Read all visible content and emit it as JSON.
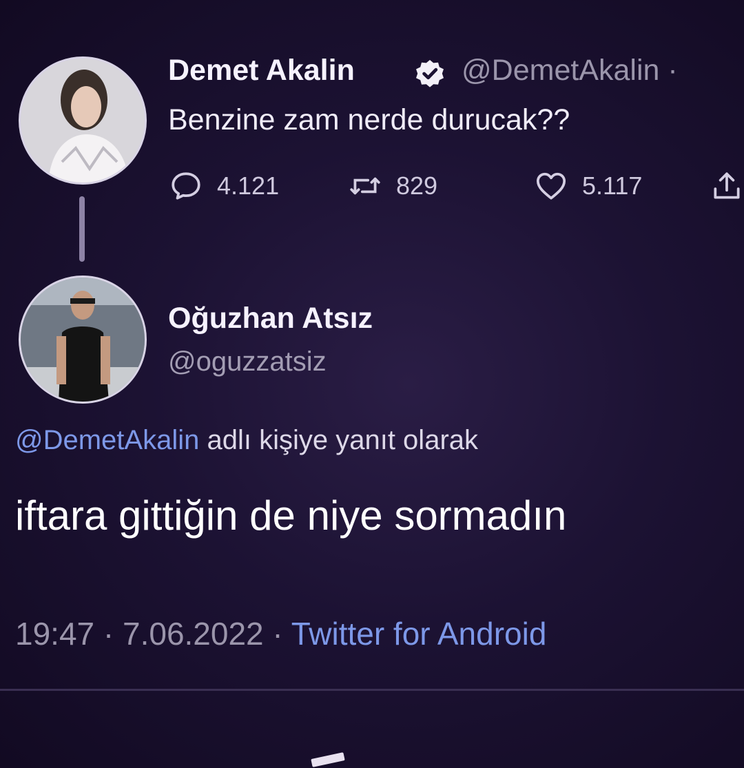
{
  "tweet": {
    "author_name": "Demet Akalin",
    "author_handle": "@DemetAkalin ·",
    "text": "Benzine zam nerde durucak??",
    "replies": "4.121",
    "retweets": "829",
    "likes": "5.117"
  },
  "reply": {
    "author_name": "Oğuzhan Atsız",
    "author_handle": "@oguzzatsiz",
    "reply_to_mention": "@DemetAkalin",
    "reply_to_suffix": " adlı kişiye yanıt olarak",
    "text": "iftara gittiğin de niye sormadın",
    "time": "19:47 · 7.06.2022 · ",
    "source": "Twitter for Android"
  },
  "icons": {
    "verified": "verified-badge-icon",
    "reply": "comment-icon",
    "retweet": "retweet-icon",
    "like": "heart-icon",
    "share": "share-icon"
  },
  "colors": {
    "background": "#1c1233",
    "link": "#7d98e8",
    "muted": "#9b95ab",
    "text": "#f2eefa"
  }
}
